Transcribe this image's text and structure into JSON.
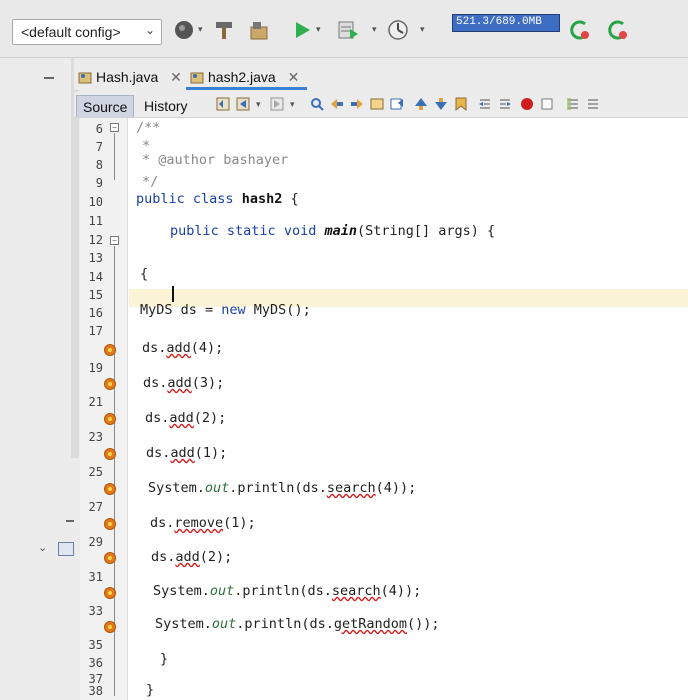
{
  "toolbar": {
    "config_value": "<default config>",
    "memory_label": "521.3/689.0MB",
    "icons": [
      "clean-build-icon",
      "hammer-icon",
      "build-icon",
      "run-icon",
      "debug-icon",
      "profile-icon",
      "gc-icon",
      "gc-alt-icon"
    ]
  },
  "tabs": [
    {
      "label": "Hash.java",
      "active": false
    },
    {
      "label": "hash2.java",
      "active": true
    }
  ],
  "editor_modes": [
    {
      "label": "Source",
      "active": true
    },
    {
      "label": "History",
      "active": false
    }
  ],
  "line_numbers": [
    "6",
    "7",
    "8",
    "9",
    "10",
    "11",
    "12",
    "13",
    "14",
    "15",
    "16",
    "17",
    "19",
    "21",
    "23",
    "25",
    "27",
    "29",
    "31",
    "33",
    "35",
    "36",
    "37",
    "38"
  ],
  "code": {
    "l6": "/**",
    "l7": "*",
    "l8": "* @author bashayer",
    "l9": "*/",
    "l10_kw1": "public",
    "l10_kw2": "class",
    "l10_name": "hash2",
    "l10_brace": "{",
    "l12_kw1": "public",
    "l12_kw2": "static",
    "l12_kw3": "void",
    "l12_method": "main",
    "l12_rest": "(String[] args) {",
    "l14": "{",
    "l16_a": "MyDS ds = ",
    "l16_kw": "new",
    "l16_b": " MyDS();",
    "c1_obj": "ds.",
    "c1_m": "add",
    "c1_args": "(4);",
    "c2_obj": "ds.",
    "c2_m": "add",
    "c2_args": "(3);",
    "c3_obj": "ds.",
    "c3_m": "add",
    "c3_args": "(2);",
    "c4_obj": "ds.",
    "c4_m": "add",
    "c4_args": "(1);",
    "c5_a": "System.",
    "c5_fld": "out",
    "c5_b": ".println(ds.",
    "c5_m": "search",
    "c5_c": "(4));",
    "c6_obj": "ds.",
    "c6_m": "remove",
    "c6_args": "(1);",
    "c7_obj": "ds.",
    "c7_m": "add",
    "c7_args": "(2);",
    "c8_a": "System.",
    "c8_fld": "out",
    "c8_b": ".println(ds.",
    "c8_m": "search",
    "c8_c": "(4));",
    "c9_a": "System.",
    "c9_fld": "out",
    "c9_b": ".println(ds.",
    "c9_m": "getRandom",
    "c9_c": "());",
    "close1": "}",
    "close2": "}"
  },
  "colors": {
    "keyword": "#1a3fa8",
    "comment": "#888888",
    "field": "#2f6f3e",
    "error": "#d11c1c",
    "current_line": "#fbf3d6",
    "memory_bar": "#3d6ec3"
  }
}
